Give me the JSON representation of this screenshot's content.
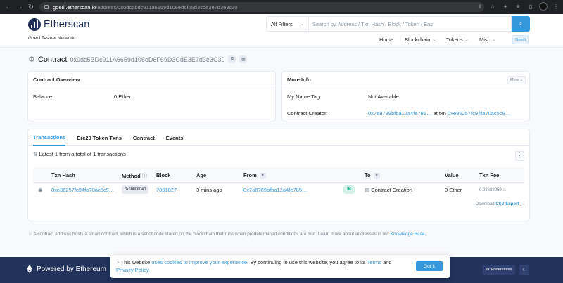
{
  "browser": {
    "url_host": "goerli.etherscan.io",
    "url_path": "/address/0x0dc5bdc911a6659d106ed6f69d3cde3e7d3e3c30"
  },
  "header": {
    "logo_text": "Etherscan",
    "network": "Goerli Testnet Network",
    "filter_label": "All Filters",
    "search_placeholder": "Search by Address / Txn Hash / Block / Token / Ens",
    "nav": {
      "home": "Home",
      "blockchain": "Blockchain",
      "tokens": "Tokens",
      "misc": "Misc",
      "badge": "Goerli"
    }
  },
  "page": {
    "title_label": "Contract",
    "address": "0x0dc5BDc911A6659d106eD6F69D3CdE3E7d3e3C30"
  },
  "overview": {
    "title": "Contract Overview",
    "balance_label": "Balance:",
    "balance_value": "0 Ether"
  },
  "more_info": {
    "title": "More Info",
    "more_button": "More",
    "name_tag_label": "My Name Tag:",
    "name_tag_value": "Not Available",
    "creator_label": "Contract Creator:",
    "creator_address": "0x7a8789bfba12a4fe785…",
    "creator_at": "at txn",
    "creator_txn": "0xe86257fc94fa70ac5c9…"
  },
  "tabs": [
    "Transactions",
    "Erc20 Token Txns",
    "Contract",
    "Events"
  ],
  "transactions": {
    "summary": "Latest 1 from a total of 1 transactions",
    "headers": {
      "hash": "Txn Hash",
      "method": "Method",
      "block": "Block",
      "age": "Age",
      "from": "From",
      "to": "To",
      "value": "Value",
      "fee": "Txn Fee"
    },
    "rows": [
      {
        "hash": "0xe86257fc94fa70ac5c9…",
        "method": "0x60806040",
        "block": "7891827",
        "age": "3 mins ago",
        "from": "0x7a8789bfba12a4fe785…",
        "direction": "IN",
        "to": "Contract Creation",
        "value": "0 Ether",
        "fee": "0.02688059"
      }
    ],
    "download_prefix": "[ Download",
    "download_link": "CSV Export",
    "download_suffix": "]"
  },
  "note": {
    "text": "A contract address hosts a smart contract, which is a set of code stored on the blockchain that runs when predetermined conditions are met. Learn more about addresses in our",
    "link": "Knowledge Base."
  },
  "footer": {
    "brand": "Powered by Ethereum",
    "preferences": "Preferences"
  },
  "cookie": {
    "prefix": "This website",
    "link1": "uses cookies to improve your experience.",
    "middle": "By continuing to use this website, you agree to its",
    "link2": "Terms",
    "and": "and",
    "link3": "Privacy Policy.",
    "button": "Got It"
  },
  "colors": {
    "accent": "#3498db",
    "navy": "#21325b",
    "success": "#00a186"
  }
}
